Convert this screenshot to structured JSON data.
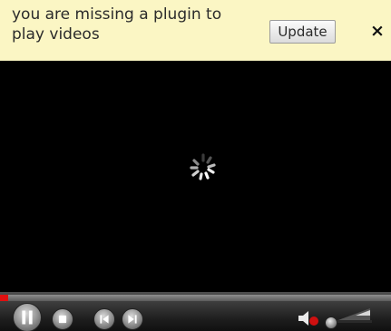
{
  "notification": {
    "message": "you are missing a plugin to play videos",
    "update_label": "Update",
    "close_label": "×"
  },
  "player": {
    "state": "loading",
    "progress_fraction": 0.02,
    "volume_fraction": 0.0,
    "icons": [
      "pause-icon",
      "stop-icon",
      "previous-icon",
      "next-icon",
      "volume-icon",
      "loading-spinner-icon"
    ]
  },
  "colors": {
    "notification_bg": "#fbf6c4",
    "video_bg": "#000000",
    "progress_played": "#e01010",
    "volume_accent": "#d01010"
  }
}
